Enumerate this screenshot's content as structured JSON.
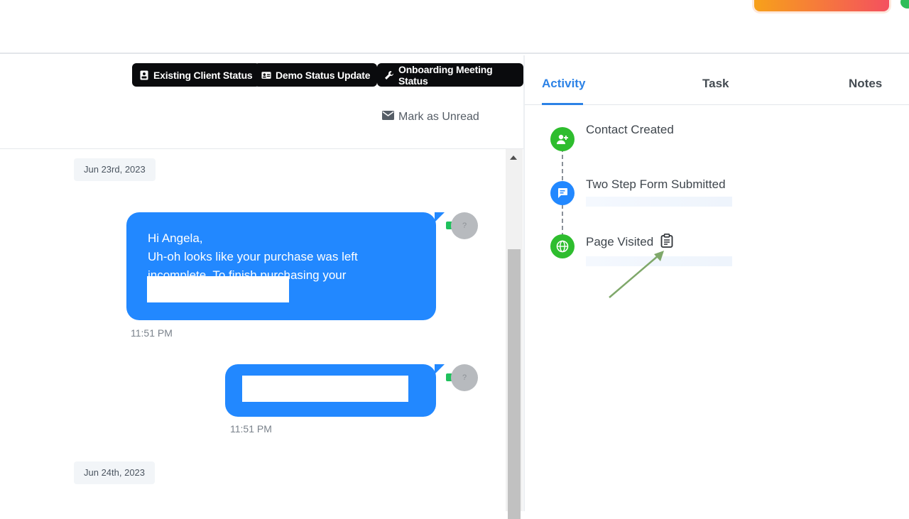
{
  "action_buttons": [
    {
      "label": "Existing Client Status",
      "icon": "contact-card-icon"
    },
    {
      "label": "Demo Status Update",
      "icon": "id-card-icon"
    },
    {
      "label": "Onboarding Meeting Status",
      "icon": "wrench-icon"
    }
  ],
  "mark_unread": {
    "label": "Mark as Unread",
    "icon": "envelope-icon"
  },
  "conversation": {
    "dates": [
      "Jun 23rd, 2023",
      "Jun 24th, 2023"
    ],
    "messages": [
      {
        "lines": [
          "Hi Angela,",
          "Uh-oh looks like your purchase was left",
          "incomplete. To finish purchasing your"
        ],
        "time": "11:51 PM"
      },
      {
        "lines": [],
        "time": "11:51 PM"
      }
    ],
    "avatar_text": "?"
  },
  "tabs": [
    "Activity",
    "Task",
    "Notes"
  ],
  "active_tab": "Activity",
  "activity": [
    {
      "title": "Contact Created",
      "icon": "add-user-icon",
      "color": "#2ebd2e"
    },
    {
      "title": "Two Step Form Submitted",
      "icon": "message-icon",
      "color": "#2288ff"
    },
    {
      "title": "Page Visited",
      "icon": "globe-icon",
      "color": "#2ebd2e"
    }
  ],
  "colors": {
    "accent": "#2c82e6",
    "bubble": "#2288ff",
    "green": "#2ebd2e",
    "pill": "#0a0b0d"
  }
}
